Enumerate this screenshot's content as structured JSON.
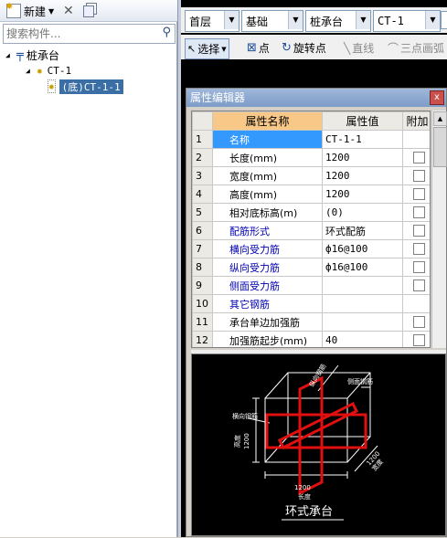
{
  "left_panel": {
    "toolbar": {
      "new_label": "新建"
    },
    "search": {
      "placeholder": "搜索构件..."
    },
    "tree": {
      "root_label": "桩承台",
      "child_label": "CT-1",
      "leaf_label": "(底)CT-1-1"
    }
  },
  "filter_bar": {
    "floor": "首层",
    "category": "基础",
    "type": "桩承台",
    "component": "CT-1"
  },
  "tool_bar": {
    "select_label": "选择",
    "point_label": "点",
    "rotate_point_label": "旋转点",
    "line_label": "直线",
    "three_point_arc_label": "三点画弧"
  },
  "property_editor": {
    "title": "属性编辑器",
    "close_glyph": "x",
    "headers": {
      "name": "属性名称",
      "value": "属性值",
      "attach": "附加"
    },
    "rows": [
      {
        "idx": "1",
        "name": "名称",
        "value": "CT-1-1",
        "checkbox": false
      },
      {
        "idx": "2",
        "name": "长度(mm)",
        "value": "1200",
        "checkbox": true
      },
      {
        "idx": "3",
        "name": "宽度(mm)",
        "value": "1200",
        "checkbox": true
      },
      {
        "idx": "4",
        "name": "高度(mm)",
        "value": "1200",
        "checkbox": true
      },
      {
        "idx": "5",
        "name": "相对底标高(m)",
        "value": "(0)",
        "checkbox": true
      },
      {
        "idx": "6",
        "name": "配筋形式",
        "value": "环式配筋",
        "checkbox": true
      },
      {
        "idx": "7",
        "name": "横向受力筋",
        "value": "ф16@100",
        "checkbox": true
      },
      {
        "idx": "8",
        "name": "纵向受力筋",
        "value": "ф16@100",
        "checkbox": true
      },
      {
        "idx": "9",
        "name": "侧面受力筋",
        "value": "",
        "checkbox": true
      },
      {
        "idx": "10",
        "name": "其它钢筋",
        "value": "",
        "checkbox": false
      },
      {
        "idx": "11",
        "name": "承台单边加强筋",
        "value": "",
        "checkbox": true
      },
      {
        "idx": "12",
        "name": "加强筋起步(mm)",
        "value": "40",
        "checkbox": true
      }
    ],
    "preview": {
      "caption": "环式承台",
      "label_horizontal_bar": "横向钢筋",
      "label_vertical_bar": "纵向钢筋",
      "label_side_bar": "侧面钢筋",
      "label_height": "高度",
      "label_height_value": "1200",
      "label_length": "长度",
      "label_length_value": "1200",
      "label_width": "宽度",
      "label_width_value": "1200"
    }
  },
  "colors": {
    "header_name_bg": "#f8c888",
    "selected_cell_bg": "#3399ff",
    "blue_text": "#0000b0",
    "rebar_red": "#e01010"
  }
}
